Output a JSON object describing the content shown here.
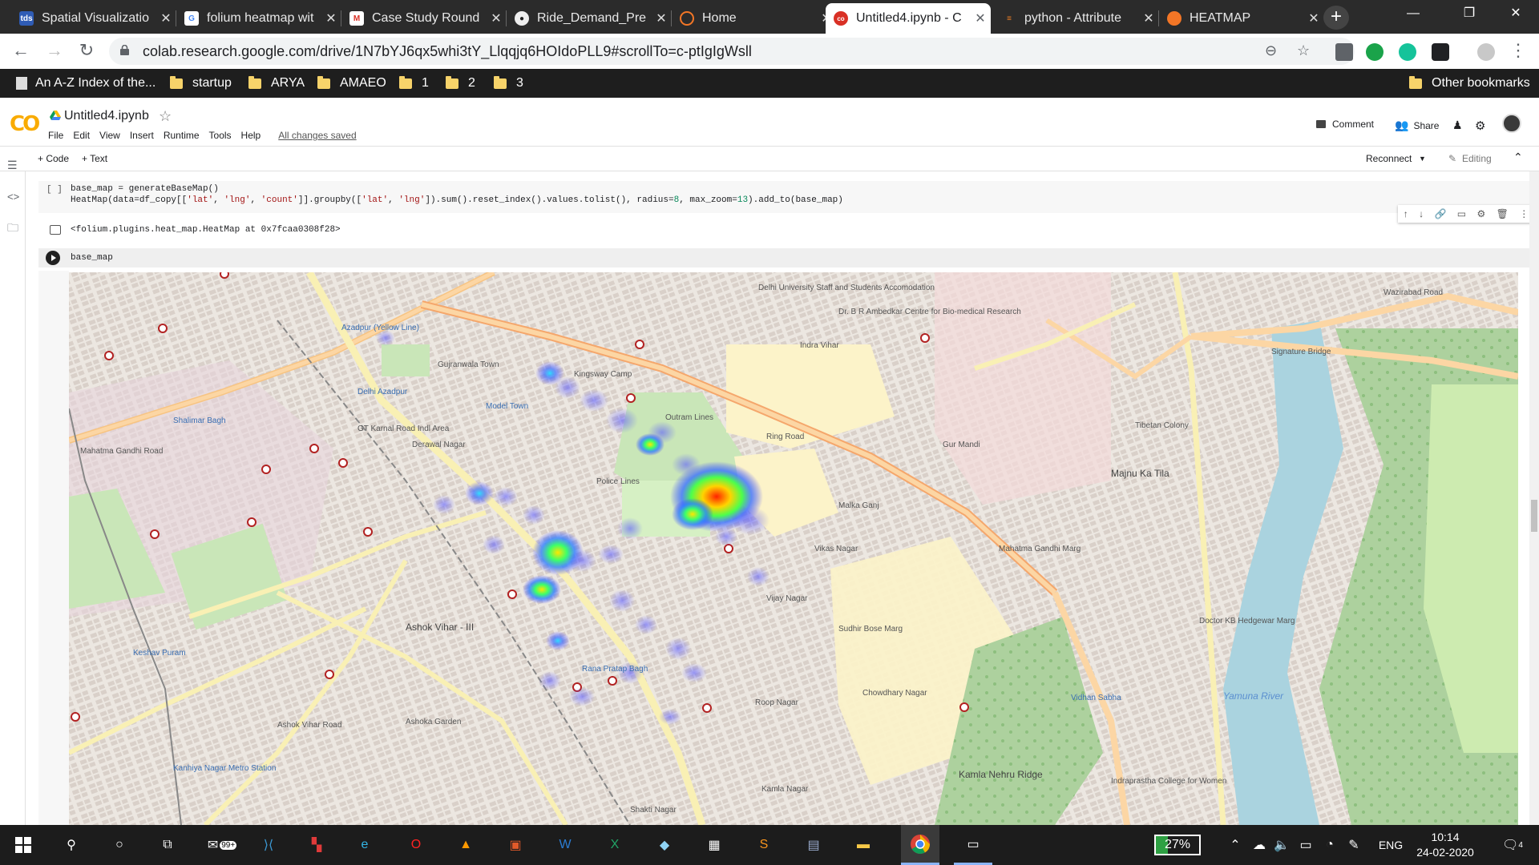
{
  "browser": {
    "tabs": [
      {
        "title": "Spatial Visualizatio",
        "favicon": "tds-favicon",
        "color": "#2f5cb5"
      },
      {
        "title": "folium heatmap wit",
        "favicon": "google-favicon",
        "color": "#4285f4"
      },
      {
        "title": "Case Study Round",
        "favicon": "gmail-favicon",
        "color": "#d93025"
      },
      {
        "title": "Ride_Demand_Pre",
        "favicon": "github-favicon",
        "color": "#eeeeee"
      },
      {
        "title": "Home",
        "favicon": "jupyter-favicon",
        "color": "#f37626"
      },
      {
        "title": "Untitled4.ipynb - C",
        "favicon": "colab-favicon",
        "color": "#f9ab00",
        "active": true
      },
      {
        "title": "python - Attribute",
        "favicon": "stackoverflow-favicon",
        "color": "#f48024"
      },
      {
        "title": "HEATMAP",
        "favicon": "jupyter-favicon",
        "color": "#f37626"
      }
    ],
    "url": "colab.research.google.com/drive/1N7bYJ6qx5whi3tY_Llqqjq6HOIdoPLL9#scrollTo=c-ptIgIgWsll",
    "bookmarks": [
      {
        "label": "An A-Z Index of the..."
      },
      {
        "label": "startup"
      },
      {
        "label": "ARYA"
      },
      {
        "label": "AMAEO"
      },
      {
        "label": "1"
      },
      {
        "label": "2"
      },
      {
        "label": "3"
      }
    ],
    "other_bookmarks": "Other bookmarks"
  },
  "colab": {
    "logo": "CO",
    "notebook_name": "Untitled4.ipynb",
    "menu": [
      "File",
      "Edit",
      "View",
      "Insert",
      "Runtime",
      "Tools",
      "Help"
    ],
    "saved_status": "All changes saved",
    "comment_label": "Comment",
    "share_label": "Share",
    "add_code_label": "+ Code",
    "add_text_label": "+ Text",
    "reconnect_label": "Reconnect",
    "editing_label": "Editing"
  },
  "cells": {
    "cell1": {
      "run_indicator": "[ ]",
      "line1": "base_map = generateBaseMap()",
      "line2_a": "HeatMap(data=df_copy[[",
      "line2_s1": "'lat'",
      "line2_b": ", ",
      "line2_s2": "'lng'",
      "line2_c": ", ",
      "line2_s3": "'count'",
      "line2_d": "]].groupby([",
      "line2_s4": "'lat'",
      "line2_e": ", ",
      "line2_s5": "'lng'",
      "line2_f": "]).sum().reset_index().values.tolist(), radius=",
      "line2_n1": "8",
      "line2_g": ", max_zoom=",
      "line2_n2": "13",
      "line2_h": ").add_to(base_map)",
      "output": "<folium.plugins.heat_map.HeatMap at 0x7fcaa0308f28>"
    },
    "cell2": {
      "code": "base_map"
    }
  },
  "map": {
    "labels": [
      "Azadpur (Yellow Line)",
      "Delhi Azadpur",
      "Shalimar Bagh",
      "GT Karnal Road Indl Area",
      "Derawal Nagar",
      "Model Town",
      "Police Lines",
      "Outram Lines",
      "Kingsway Camp",
      "Delhi University Staff and Students Accomodation",
      "Dr. B R Ambedkar Centre for Bio-medical Research",
      "Indra Vihar",
      "Majnu Ka Tila",
      "Tibetan Colony",
      "Ashok Vihar - III",
      "Keshav Puram",
      "Rana Pratap Bagh",
      "Vijay Nagar",
      "Roop Nagar",
      "Ashoka Garden",
      "Kanhiya Nagar Metro Station",
      "Kamla Nehru Ridge",
      "Vidhan Sabha",
      "Yamuna River",
      "Shakti Nagar",
      "Kamla Nagar",
      "Mahatma Gandhi Road",
      "Wazirabad Road",
      "Signature Bridge",
      "Ring Road",
      "Ashok Vihar Road",
      "Mahatma Gandhi Marg",
      "Doctor KB Hedgewar Marg",
      "Gujranwala Town",
      "Malka Ganj",
      "Sudhir Bose Marg",
      "Chowdhary Nagar",
      "Indraprastha College for Women",
      "Vikas Nagar",
      "Gur Mandi"
    ]
  },
  "taskbar": {
    "battery": "27%",
    "language": "ENG",
    "time": "10:14",
    "date": "24-02-2020",
    "notifications": "4",
    "mail_badge": "99+"
  }
}
